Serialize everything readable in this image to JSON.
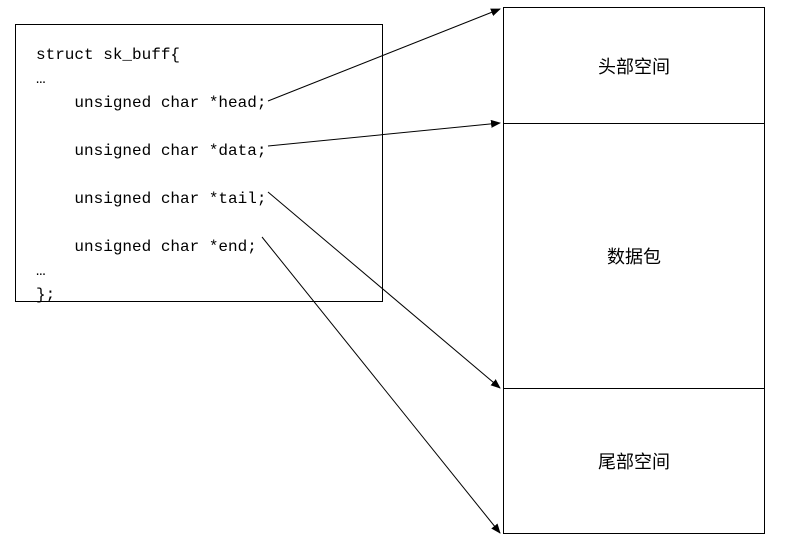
{
  "struct": {
    "decl": "struct sk_buff{",
    "ellipsis1": "…",
    "fields": [
      "unsigned char *head;",
      "unsigned char *data;",
      "unsigned char *tail;",
      "unsigned char *end;"
    ],
    "ellipsis2": "…",
    "close": "};"
  },
  "regions": {
    "head": "头部空间",
    "data": "数据包",
    "tail": "尾部空间"
  },
  "pointer_map": [
    {
      "field": "head",
      "points_to_boundary": "top-of-head-region"
    },
    {
      "field": "data",
      "points_to_boundary": "top-of-data-region"
    },
    {
      "field": "tail",
      "points_to_boundary": "top-of-tail-region"
    },
    {
      "field": "end",
      "points_to_boundary": "bottom-of-tail-region"
    }
  ]
}
